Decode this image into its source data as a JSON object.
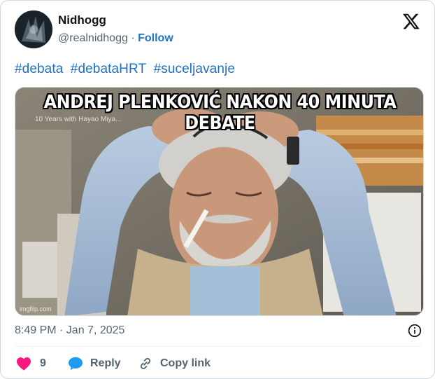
{
  "author": {
    "name": "Nidhogg",
    "handle": "@realnidhogg",
    "separator": "·",
    "follow_label": "Follow"
  },
  "tweet": {
    "hashtags": [
      "#debata",
      "#debataHRT",
      "#suceljavanje"
    ]
  },
  "media": {
    "caption": "ANDREJ PLENKOVIĆ NAKON 40 MINUTA DEBATE",
    "subtitle": "10 Years with Hayao Miya...",
    "watermark": "imgflip.com"
  },
  "meta": {
    "timestamp": "8:49 PM · Jan 7, 2025"
  },
  "actions": {
    "like_count": "9",
    "reply_label": "Reply",
    "copy_label": "Copy link"
  },
  "icons": {
    "x_logo": "x-logo-icon",
    "info": "info-icon",
    "heart": "heart-icon",
    "reply": "reply-bubble-icon",
    "link": "link-icon"
  },
  "colors": {
    "accent": "#1d74c7",
    "heart": "#f91880",
    "reply": "#1d9bf0",
    "muted": "#536471"
  }
}
